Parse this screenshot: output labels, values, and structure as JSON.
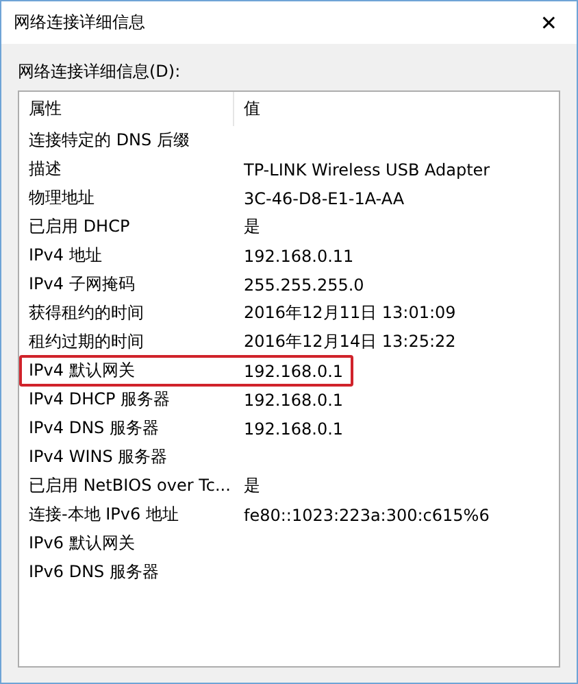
{
  "window": {
    "title": "网络连接详细信息",
    "close": "✕"
  },
  "list_label": "网络连接详细信息(D):",
  "table": {
    "columns": [
      "属性",
      "值"
    ],
    "rows": [
      {
        "property": "连接特定的 DNS 后缀",
        "value": "",
        "highlighted": false
      },
      {
        "property": "描述",
        "value": "TP-LINK Wireless USB Adapter",
        "highlighted": false
      },
      {
        "property": "物理地址",
        "value": "3C-46-D8-E1-1A-AA",
        "highlighted": false
      },
      {
        "property": "已启用 DHCP",
        "value": "是",
        "highlighted": false
      },
      {
        "property": "IPv4 地址",
        "value": "192.168.0.11",
        "highlighted": false
      },
      {
        "property": "IPv4 子网掩码",
        "value": "255.255.255.0",
        "highlighted": false
      },
      {
        "property": "获得租约的时间",
        "value": "2016年12月11日 13:01:09",
        "highlighted": false
      },
      {
        "property": "租约过期的时间",
        "value": "2016年12月14日 13:25:22",
        "highlighted": false
      },
      {
        "property": "IPv4 默认网关",
        "value": "192.168.0.1",
        "highlighted": true
      },
      {
        "property": "IPv4 DHCP 服务器",
        "value": "192.168.0.1",
        "highlighted": false
      },
      {
        "property": "IPv4 DNS 服务器",
        "value": "192.168.0.1",
        "highlighted": false
      },
      {
        "property": "IPv4 WINS 服务器",
        "value": "",
        "highlighted": false
      },
      {
        "property": "已启用 NetBIOS over Tc...",
        "value": "是",
        "highlighted": false
      },
      {
        "property": "连接-本地 IPv6 地址",
        "value": "fe80::1023:223a:300:c615%6",
        "highlighted": false
      },
      {
        "property": "IPv6 默认网关",
        "value": "",
        "highlighted": false
      },
      {
        "property": "IPv6 DNS 服务器",
        "value": "",
        "highlighted": false
      }
    ]
  }
}
